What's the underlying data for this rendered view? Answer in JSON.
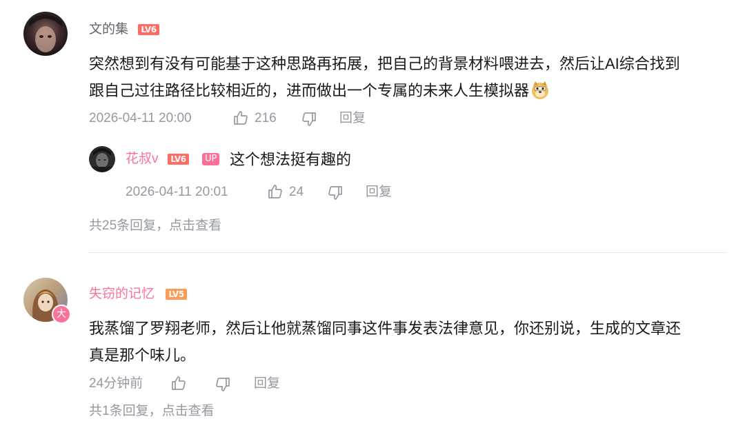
{
  "comments": [
    {
      "username": "文的集",
      "level": "LV6",
      "text_line1": "突然想到有没有可能基于这种思路再拓展，把自己的背景材料喂进去，然后让AI综合找到",
      "text_line2": "跟自己过往路径比较相近的，进而做出一个专属的未来人生模拟器",
      "emoji_icon": "doge-emoji-icon",
      "time": "2026-04-11 20:00",
      "likes": "216",
      "reply_label": "回复",
      "reply": {
        "username": "花叔v",
        "level": "LV6",
        "up_badge": "UP",
        "text": "这个想法挺有趣的",
        "time": "2026-04-11 20:01",
        "likes": "24",
        "reply_label": "回复"
      },
      "reply_summary": "共25条回复，点击查看"
    },
    {
      "username": "失窃的记忆",
      "level": "LV5",
      "avatar_badge": "大",
      "text_line1": "我蒸馏了罗翔老师，然后让他就蒸馏同事这件事发表法律意见，你还别说，生成的文章还",
      "text_line2": "真是那个味儿。",
      "time": "24分钟前",
      "reply_label": "回复",
      "reply_summary": "共1条回复，点击查看"
    }
  ],
  "colors": {
    "username_default": "#61666d",
    "username_vip": "#fb7299",
    "level6": "#ff6c63",
    "level5": "#ff9a56",
    "meta_text": "#9499a0",
    "content_text": "#18191c",
    "divider": "#e3e5e7"
  }
}
